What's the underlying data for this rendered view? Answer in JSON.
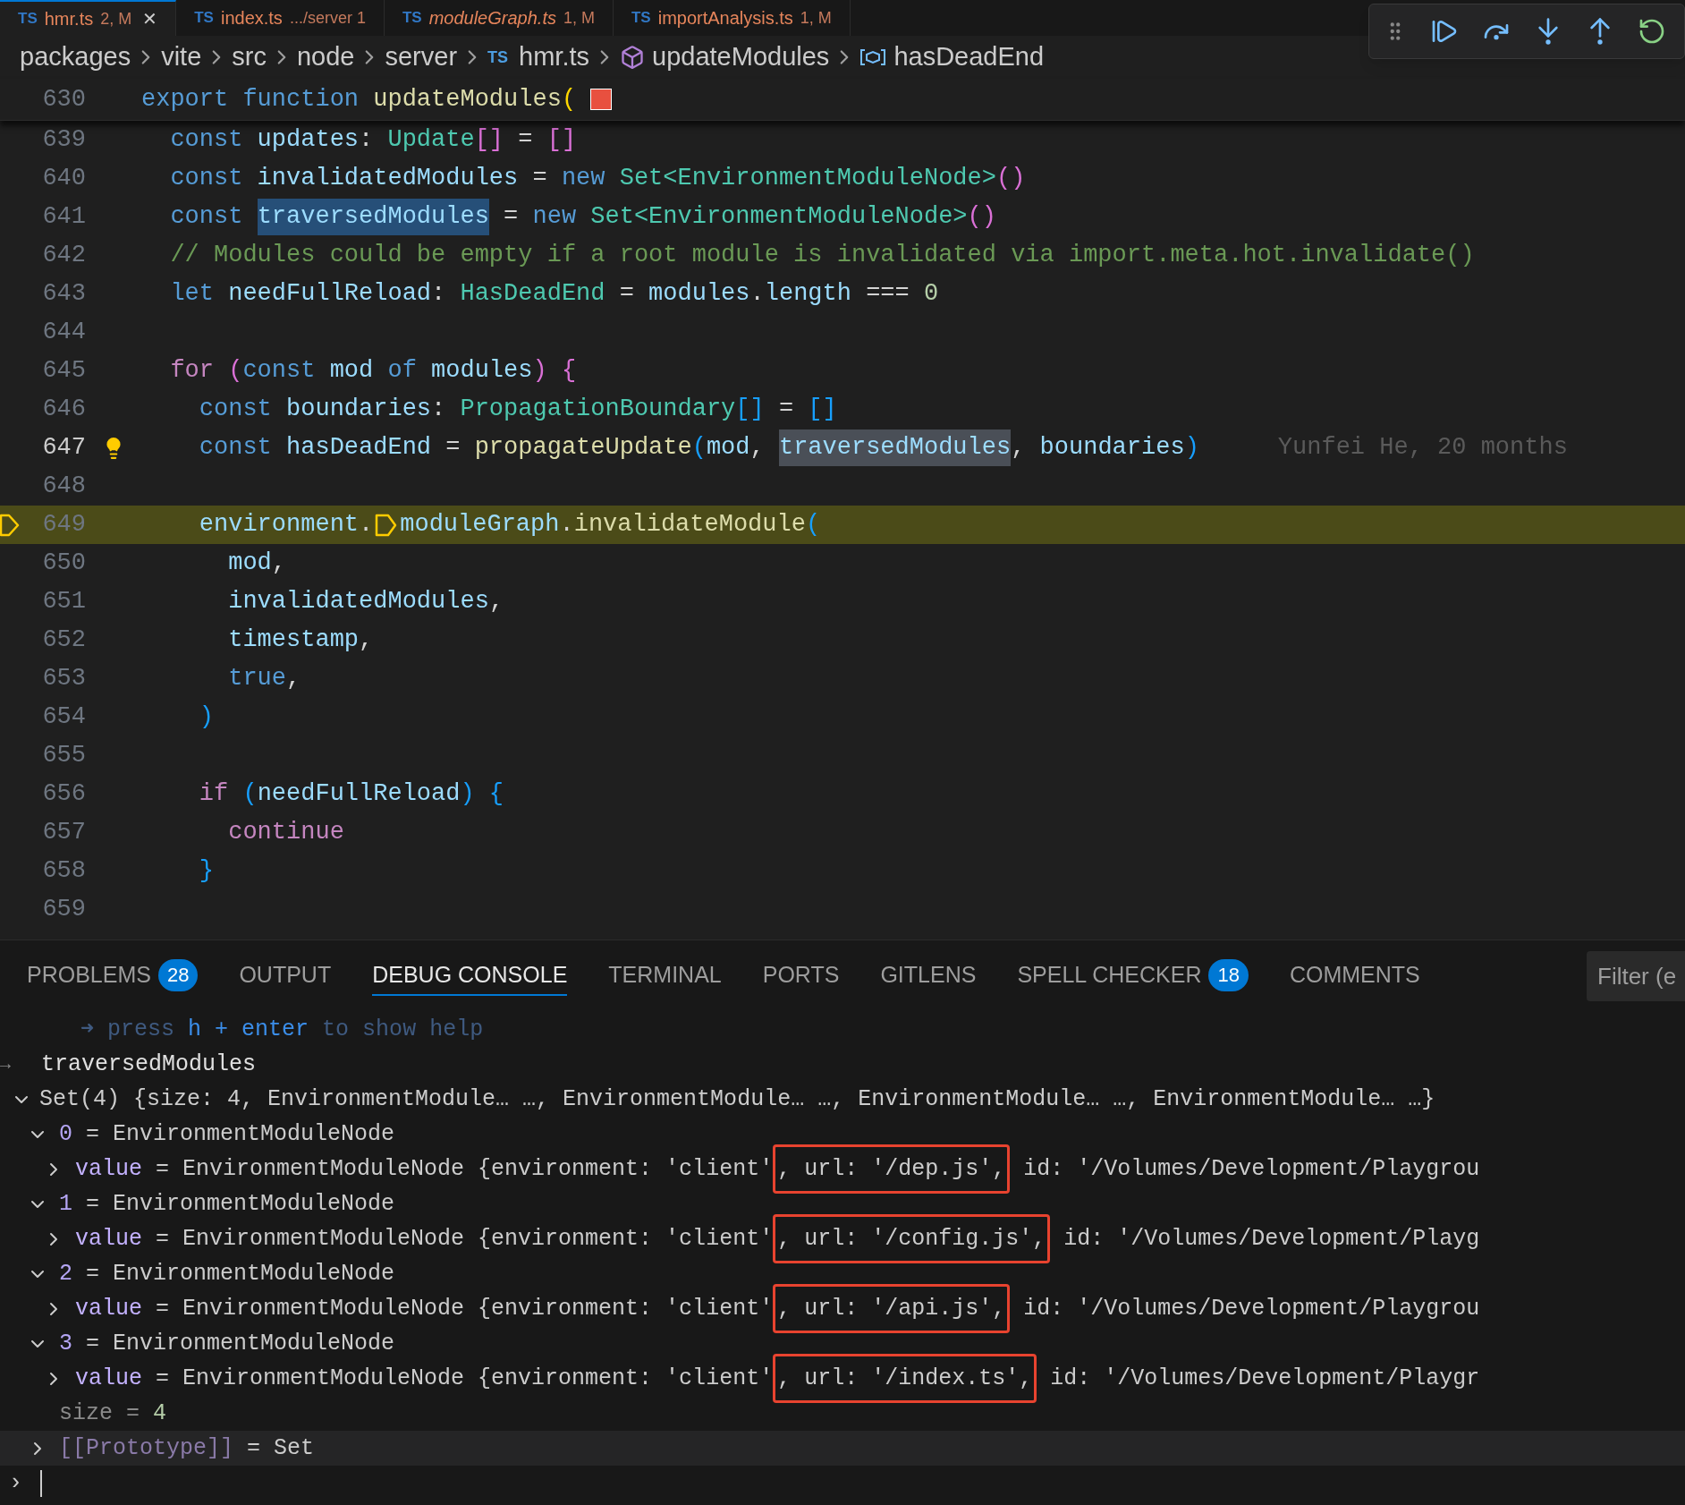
{
  "editor_tabs": [
    {
      "icon": "TS",
      "name": "hmr.ts",
      "detail": "2, M",
      "selected": true,
      "preview": false,
      "close": "✕"
    },
    {
      "icon": "TS",
      "name": "index.ts",
      "detail": ".../server 1",
      "selected": false,
      "preview": false
    },
    {
      "icon": "TS",
      "name": "moduleGraph.ts",
      "detail": "1, M",
      "selected": false,
      "preview": true
    },
    {
      "icon": "TS",
      "name": "importAnalysis.ts",
      "detail": "1, M",
      "selected": false,
      "preview": false
    }
  ],
  "breadcrumb": [
    {
      "kind": "folder",
      "label": "packages"
    },
    {
      "kind": "folder",
      "label": "vite"
    },
    {
      "kind": "folder",
      "label": "src"
    },
    {
      "kind": "folder",
      "label": "node"
    },
    {
      "kind": "folder",
      "label": "server"
    },
    {
      "kind": "file",
      "icon": "TS",
      "label": "hmr.ts"
    },
    {
      "kind": "function",
      "label": "updateModules"
    },
    {
      "kind": "variable",
      "label": "hasDeadEnd"
    }
  ],
  "sticky_line": {
    "number": "630",
    "tokens": [
      {
        "t": "export",
        "kind": "kw"
      },
      {
        "t": " function",
        "kind": "kw"
      },
      {
        "t": " updateModules",
        "kind": "fn"
      },
      {
        "t": "(",
        "kind": "b1"
      },
      {
        "kind": "square"
      }
    ]
  },
  "code_lines": [
    {
      "number": "639",
      "current": false,
      "cursor": false,
      "tokens": [
        {
          "t": "  const",
          "kind": "kw"
        },
        {
          "t": " updates",
          "kind": "var"
        },
        {
          "t": ":",
          "kind": "p"
        },
        {
          "t": " Update",
          "kind": "type"
        },
        {
          "t": "[]",
          "kind": "b2"
        },
        {
          "t": " = ",
          "kind": "p"
        },
        {
          "t": "[]",
          "kind": "b2"
        }
      ]
    },
    {
      "number": "640",
      "current": false,
      "cursor": false,
      "tokens": [
        {
          "t": "  const",
          "kind": "kw"
        },
        {
          "t": " invalidatedModules",
          "kind": "var"
        },
        {
          "t": " = ",
          "kind": "p"
        },
        {
          "t": "new",
          "kind": "kw"
        },
        {
          "t": " Set<EnvironmentModuleNode>",
          "kind": "type"
        },
        {
          "t": "()",
          "kind": "b2"
        }
      ]
    },
    {
      "number": "641",
      "current": false,
      "cursor": false,
      "tokens": [
        {
          "t": "  const ",
          "kind": "kw"
        },
        {
          "t": "traversedModules",
          "kind": "sel"
        },
        {
          "t": " = ",
          "kind": "p"
        },
        {
          "t": "new",
          "kind": "kw"
        },
        {
          "t": " Set<EnvironmentModuleNode>",
          "kind": "type"
        },
        {
          "t": "()",
          "kind": "b2"
        }
      ]
    },
    {
      "number": "642",
      "current": false,
      "cursor": false,
      "tokens": [
        {
          "t": "  // Modules could be empty if a root module is invalidated via import.meta.hot.invalidate()",
          "kind": "comment"
        }
      ]
    },
    {
      "number": "643",
      "current": false,
      "cursor": false,
      "tokens": [
        {
          "t": "  let",
          "kind": "kw"
        },
        {
          "t": " needFullReload",
          "kind": "var"
        },
        {
          "t": ":",
          "kind": "p"
        },
        {
          "t": " HasDeadEnd",
          "kind": "type"
        },
        {
          "t": " = ",
          "kind": "p"
        },
        {
          "t": "modules",
          "kind": "var"
        },
        {
          "t": ".",
          "kind": "p"
        },
        {
          "t": "length",
          "kind": "var"
        },
        {
          "t": " === ",
          "kind": "p"
        },
        {
          "t": "0",
          "kind": "num"
        }
      ]
    },
    {
      "number": "644",
      "current": false,
      "cursor": false
    },
    {
      "number": "645",
      "current": false,
      "cursor": false,
      "tokens": [
        {
          "t": "  for",
          "kind": "ctrl"
        },
        {
          "t": " (",
          "kind": "b2"
        },
        {
          "t": "const",
          "kind": "kw"
        },
        {
          "t": " mod",
          "kind": "var"
        },
        {
          "t": " of",
          "kind": "kw"
        },
        {
          "t": " modules",
          "kind": "var"
        },
        {
          "t": ")",
          "kind": "b2"
        },
        {
          "t": " {",
          "kind": "b2"
        }
      ]
    },
    {
      "number": "646",
      "current": false,
      "cursor": false,
      "tokens": [
        {
          "t": "    const",
          "kind": "kw"
        },
        {
          "t": " boundaries",
          "kind": "var"
        },
        {
          "t": ":",
          "kind": "p"
        },
        {
          "t": " PropagationBoundary",
          "kind": "type"
        },
        {
          "t": "[]",
          "kind": "b3"
        },
        {
          "t": " = ",
          "kind": "p"
        },
        {
          "t": "[]",
          "kind": "b3"
        }
      ]
    },
    {
      "number": "647",
      "current": false,
      "cursor": true,
      "blame": "Yunfei He, 20 months",
      "tokens": [
        {
          "t": "    const",
          "kind": "kw"
        },
        {
          "t": " hasDeadEnd",
          "kind": "var"
        },
        {
          "t": " = ",
          "kind": "p"
        },
        {
          "t": "propagateUpdate",
          "kind": "fn"
        },
        {
          "t": "(",
          "kind": "b3"
        },
        {
          "t": "mod",
          "kind": "var"
        },
        {
          "t": ", ",
          "kind": "p"
        },
        {
          "t": "traversedModules",
          "kind": "occ"
        },
        {
          "t": ",",
          "kind": "p"
        },
        {
          "t": " boundaries",
          "kind": "var"
        },
        {
          "t": ")",
          "kind": "b3"
        }
      ]
    },
    {
      "number": "648",
      "current": false,
      "cursor": false
    },
    {
      "number": "649",
      "current": true,
      "cursor": false,
      "tokens": [
        {
          "t": "    environment",
          "kind": "var"
        },
        {
          "t": ".",
          "kind": "p"
        },
        {
          "kind": "stop"
        },
        {
          "t": "moduleGraph",
          "kind": "var"
        },
        {
          "t": ".",
          "kind": "p"
        },
        {
          "t": "invalidateModule",
          "kind": "fn"
        },
        {
          "t": "(",
          "kind": "b3"
        }
      ]
    },
    {
      "number": "650",
      "current": false,
      "cursor": false,
      "tokens": [
        {
          "t": "      mod",
          "kind": "var"
        },
        {
          "t": ",",
          "kind": "p"
        }
      ]
    },
    {
      "number": "651",
      "current": false,
      "cursor": false,
      "tokens": [
        {
          "t": "      invalidatedModules",
          "kind": "var"
        },
        {
          "t": ",",
          "kind": "p"
        }
      ]
    },
    {
      "number": "652",
      "current": false,
      "cursor": false,
      "tokens": [
        {
          "t": "      timestamp",
          "kind": "var"
        },
        {
          "t": ",",
          "kind": "p"
        }
      ]
    },
    {
      "number": "653",
      "current": false,
      "cursor": false,
      "tokens": [
        {
          "t": "      true",
          "kind": "kw"
        },
        {
          "t": ",",
          "kind": "p"
        }
      ]
    },
    {
      "number": "654",
      "current": false,
      "cursor": false,
      "tokens": [
        {
          "t": "    )",
          "kind": "b3"
        }
      ]
    },
    {
      "number": "655",
      "current": false,
      "cursor": false
    },
    {
      "number": "656",
      "current": false,
      "cursor": false,
      "tokens": [
        {
          "t": "    if",
          "kind": "ctrl"
        },
        {
          "t": " (",
          "kind": "b3"
        },
        {
          "t": "needFullReload",
          "kind": "var"
        },
        {
          "t": ")",
          "kind": "b3"
        },
        {
          "t": " {",
          "kind": "b3"
        }
      ]
    },
    {
      "number": "657",
      "current": false,
      "cursor": false,
      "tokens": [
        {
          "t": "      continue",
          "kind": "ctrl"
        }
      ]
    },
    {
      "number": "658",
      "current": false,
      "cursor": false,
      "tokens": [
        {
          "t": "    }",
          "kind": "b3"
        }
      ]
    },
    {
      "number": "659",
      "current": false,
      "cursor": false
    }
  ],
  "panel_tabs": [
    {
      "label": "PROBLEMS",
      "badge": "28",
      "selected": false
    },
    {
      "label": "OUTPUT",
      "selected": false
    },
    {
      "label": "DEBUG CONSOLE",
      "selected": true
    },
    {
      "label": "TERMINAL",
      "selected": false
    },
    {
      "label": "PORTS",
      "selected": false
    },
    {
      "label": "GITLENS",
      "selected": false
    },
    {
      "label": "SPELL CHECKER",
      "badge": "18",
      "selected": false
    },
    {
      "label": "COMMENTS",
      "selected": false
    }
  ],
  "filter": {
    "placeholder": "Filter (e"
  },
  "console": {
    "output": [
      {
        "t": "➜ press ",
        "kind": "dim"
      },
      {
        "t": "h + enter",
        "kind": "bright"
      },
      {
        "t": " to show help",
        "kind": "dim"
      }
    ],
    "input_marker": "→",
    "input": "traversedModules",
    "result": {
      "kind": "group",
      "label": "Set(4) {size: 4, EnvironmentModule… …, EnvironmentModule… …, EnvironmentModule… …, EnvironmentModule… …}",
      "expanded": true,
      "children": [
        {
          "kind": "group",
          "key": "0",
          "sep": "=",
          "value": "EnvironmentModuleNode",
          "expanded": true,
          "children": [
            {
              "kind": "group",
              "key": "value",
              "sep": "=",
              "value": "EnvironmentModuleNode {environment: 'client'",
              "outlined": ", url: '/dep.js',",
              "rest": " id: '/Volumes/Development/Playgrou",
              "expanded": false
            }
          ]
        },
        {
          "kind": "group",
          "key": "1",
          "sep": "=",
          "value": "EnvironmentModuleNode",
          "expanded": true,
          "children": [
            {
              "kind": "group",
              "key": "value",
              "sep": "=",
              "value": "EnvironmentModuleNode {environment: 'client'",
              "outlined": ", url: '/config.js',",
              "rest": " id: '/Volumes/Development/Playg",
              "expanded": false
            }
          ]
        },
        {
          "kind": "group",
          "key": "2",
          "sep": "=",
          "value": "EnvironmentModuleNode",
          "expanded": true,
          "children": [
            {
              "kind": "group",
              "key": "value",
              "sep": "=",
              "value": "EnvironmentModuleNode {environment: 'client'",
              "outlined": ", url: '/api.js',",
              "rest": " id: '/Volumes/Development/Playgrou",
              "expanded": false
            }
          ]
        },
        {
          "kind": "group",
          "key": "3",
          "sep": "=",
          "value": "EnvironmentModuleNode",
          "expanded": true,
          "children": [
            {
              "kind": "group",
              "key": "value",
              "sep": "=",
              "value": "EnvironmentModuleNode {environment: 'client'",
              "outlined": ", url: '/index.ts',",
              "rest": " id: '/Volumes/Development/Playgr",
              "expanded": false
            }
          ]
        },
        {
          "kind": "leaf",
          "key": "size",
          "sep": "=",
          "value": "4"
        },
        {
          "kind": "internal",
          "key": "[[Prototype]]",
          "sep": "=",
          "value": "Set",
          "expanded": false
        }
      ]
    },
    "prompt": "›"
  }
}
